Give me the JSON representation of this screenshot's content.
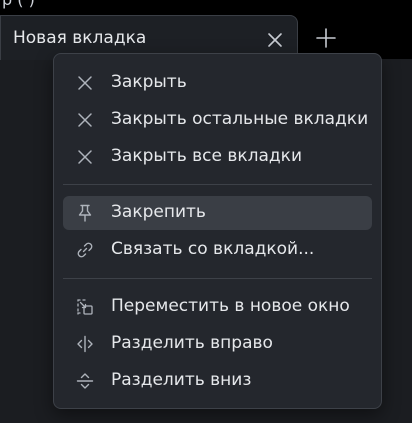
{
  "tab": {
    "title": "Новая вкладка",
    "close_icon": "close-icon",
    "new_tab_icon": "plus-icon"
  },
  "top_strip": {
    "text": "p (  )"
  },
  "menu": {
    "groups": [
      [
        {
          "label": "Закрыть",
          "icon": "close-icon"
        },
        {
          "label": "Закрыть остальные вкладки",
          "icon": "close-icon"
        },
        {
          "label": "Закрыть все вкладки",
          "icon": "close-icon"
        }
      ],
      [
        {
          "label": "Закрепить",
          "icon": "pin-icon",
          "highlighted": true
        },
        {
          "label": "Связать со вкладкой...",
          "icon": "link-icon"
        }
      ],
      [
        {
          "label": "Переместить в новое окно",
          "icon": "move-to-window-icon"
        },
        {
          "label": "Разделить вправо",
          "icon": "split-right-icon"
        },
        {
          "label": "Разделить вниз",
          "icon": "split-down-icon"
        }
      ]
    ]
  },
  "colors": {
    "menu_bg": "#24272d",
    "highlight_bg": "#3a3e45",
    "text": "#e6e8eb",
    "icon": "#aeb3bb"
  }
}
